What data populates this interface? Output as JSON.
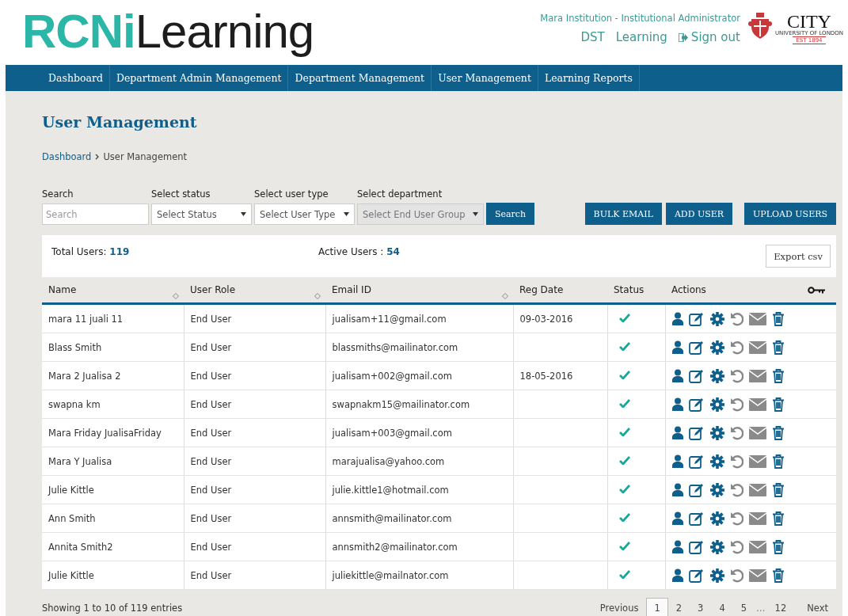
{
  "logo": {
    "part_1": "RCNi",
    "part_2": "Learning"
  },
  "header": {
    "account": "Mara Institution - Institutional Administrator",
    "links": [
      {
        "label": "DST",
        "kind": "text"
      },
      {
        "label": "Learning",
        "kind": "text"
      },
      {
        "label": "Sign out",
        "kind": "signout"
      }
    ],
    "partner_logo": {
      "name": "CITY",
      "subtitle": "UNIVERSITY OF LONDON",
      "est": "EST 1894"
    }
  },
  "nav": [
    {
      "label": "Dashboard",
      "selected": false
    },
    {
      "label": "Department Admin Management",
      "selected": false
    },
    {
      "label": "Department Management",
      "selected": false
    },
    {
      "label": "User Management",
      "selected": false
    },
    {
      "label": "Learning Reports",
      "selected": false
    }
  ],
  "page_title": "User Management",
  "breadcrumb": [
    "Dashboard",
    "User Management"
  ],
  "filters": [
    {
      "label": "Search",
      "kind": "input",
      "placeholder": "Search",
      "disabled": false
    },
    {
      "label": "Select status",
      "kind": "select",
      "value": "Select Status",
      "disabled": false
    },
    {
      "label": "Select user type",
      "kind": "select",
      "value": "Select User Type",
      "disabled": false
    },
    {
      "label": "Select department",
      "kind": "select",
      "value": "Select End User Group",
      "disabled": true
    }
  ],
  "search_button": "Search",
  "action_buttons": [
    "BULK EMAIL",
    "ADD USER",
    "UPLOAD USERS"
  ],
  "summary": {
    "total_label": "Total Users:",
    "total": "119",
    "active_label": "Active Users :",
    "active": "54",
    "export_button": "Export csv"
  },
  "table": {
    "columns": [
      {
        "label": "Name",
        "sortable": true
      },
      {
        "label": "User Role",
        "sortable": true
      },
      {
        "label": "Email ID",
        "sortable": true
      },
      {
        "label": "Reg Date",
        "sortable": false
      },
      {
        "label": "Status",
        "sortable": false
      },
      {
        "label": "Actions",
        "sortable": false
      }
    ],
    "rows": [
      {
        "name": "mara 11 juali 11",
        "role": "End User",
        "email": "jualisam+11@gmail.com",
        "reg_date": "09-03-2016",
        "active": true
      },
      {
        "name": "Blass Smith",
        "role": "End User",
        "email": "blassmiths@mailinator.com",
        "active": true
      },
      {
        "name": "Mara 2 Jualisa 2",
        "role": "End User",
        "email": "jualisam+002@gmail.com",
        "reg_date": "18-05-2016",
        "active": true
      },
      {
        "name": "swapna km",
        "role": "End User",
        "email": "swapnakm15@mailinator.com",
        "active": true
      },
      {
        "name": "Mara Friday JualisaFriday",
        "role": "End User",
        "email": "jualisam+003@gmail.com",
        "active": true
      },
      {
        "name": "Mara Y Jualisa",
        "role": "End User",
        "email": "marajualisa@yahoo.com",
        "active": true
      },
      {
        "name": "Julie Kittle",
        "role": "End User",
        "email": "julie.kittle1@hotmail.com",
        "active": true
      },
      {
        "name": "Ann Smith",
        "role": "End User",
        "email": "annsmith@mailinator.com",
        "active": true
      },
      {
        "name": "Annita Smith2",
        "role": "End User",
        "email": "annsmith2@mailinator.com",
        "active": true
      },
      {
        "name": "Julie Kittle",
        "role": "End User",
        "email": "juliekittle@mailnator.com",
        "active": true
      }
    ]
  },
  "footer": {
    "info": "Showing 1 to 10 of 119 entries",
    "previous": "Previous",
    "pages": [
      {
        "label": "1",
        "selected": true,
        "kind": "page"
      },
      {
        "label": "2",
        "selected": false,
        "kind": "page"
      },
      {
        "label": "3",
        "selected": false,
        "kind": "page"
      },
      {
        "label": "4",
        "selected": false,
        "kind": "page"
      },
      {
        "label": "5",
        "selected": false,
        "kind": "page"
      },
      {
        "label": "…",
        "kind": "ellipsis"
      },
      {
        "label": "12",
        "selected": false,
        "kind": "page"
      }
    ],
    "next": "Next"
  }
}
